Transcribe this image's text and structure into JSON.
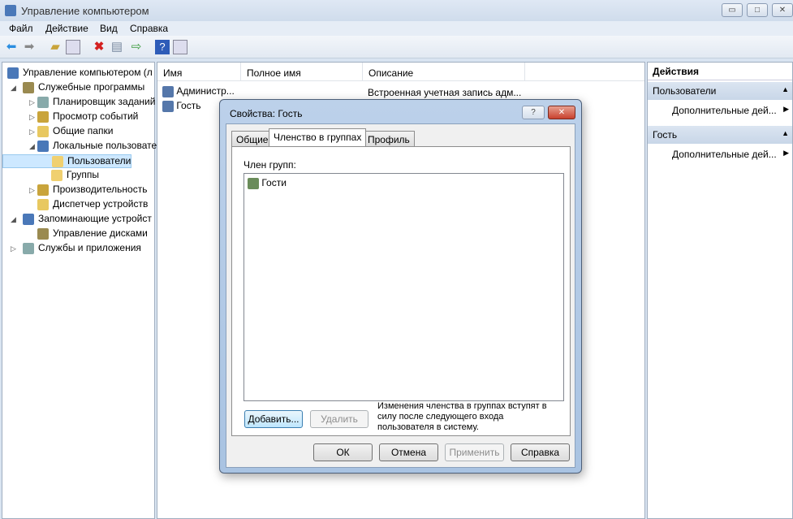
{
  "window": {
    "title": "Управление компьютером",
    "min": "▭",
    "max": "□",
    "close": "✕"
  },
  "menu": [
    "Файл",
    "Действие",
    "Вид",
    "Справка"
  ],
  "tree": [
    {
      "label": "Управление компьютером (л",
      "level": 0,
      "arrow": ""
    },
    {
      "label": "Служебные программы",
      "level": 1,
      "arrow": "◢"
    },
    {
      "label": "Планировщик заданий",
      "level": 2,
      "arrow": "▷"
    },
    {
      "label": "Просмотр событий",
      "level": 2,
      "arrow": "▷"
    },
    {
      "label": "Общие папки",
      "level": 2,
      "arrow": "▷"
    },
    {
      "label": "Локальные пользовате",
      "level": 2,
      "arrow": "◢"
    },
    {
      "label": "Пользователи",
      "level": 3,
      "arrow": ""
    },
    {
      "label": "Группы",
      "level": 3,
      "arrow": ""
    },
    {
      "label": "Производительность",
      "level": 2,
      "arrow": "▷"
    },
    {
      "label": "Диспетчер устройств",
      "level": 2,
      "arrow": ""
    },
    {
      "label": "Запоминающие устройст",
      "level": 1,
      "arrow": "◢"
    },
    {
      "label": "Управление дисками",
      "level": 2,
      "arrow": ""
    },
    {
      "label": "Службы и приложения",
      "level": 1,
      "arrow": "▷"
    }
  ],
  "list": {
    "headers": [
      "Имя",
      "Полное имя",
      "Описание"
    ],
    "rows": [
      {
        "name": "Администр...",
        "full": "",
        "desc": "Встроенная учетная запись адм..."
      },
      {
        "name": "Гость",
        "full": "",
        "desc": ""
      }
    ]
  },
  "actions": {
    "title": "Действия",
    "sections": [
      {
        "header": "Пользователи",
        "item": "Дополнительные дей..."
      },
      {
        "header": "Гость",
        "item": "Дополнительные дей..."
      }
    ]
  },
  "dialog": {
    "title": "Свойства: Гость",
    "help": "?",
    "close": "✕",
    "tabs": [
      "Общие",
      "Членство в группах",
      "Профиль"
    ],
    "member_label": "Член групп:",
    "groups": [
      "Гости"
    ],
    "add": "Добавить...",
    "remove": "Удалить",
    "note": "Изменения членства в группах вступят в силу после следующего входа пользователя в систему.",
    "ok": "ОК",
    "cancel": "Отмена",
    "apply": "Применить",
    "helpbtn": "Справка"
  }
}
